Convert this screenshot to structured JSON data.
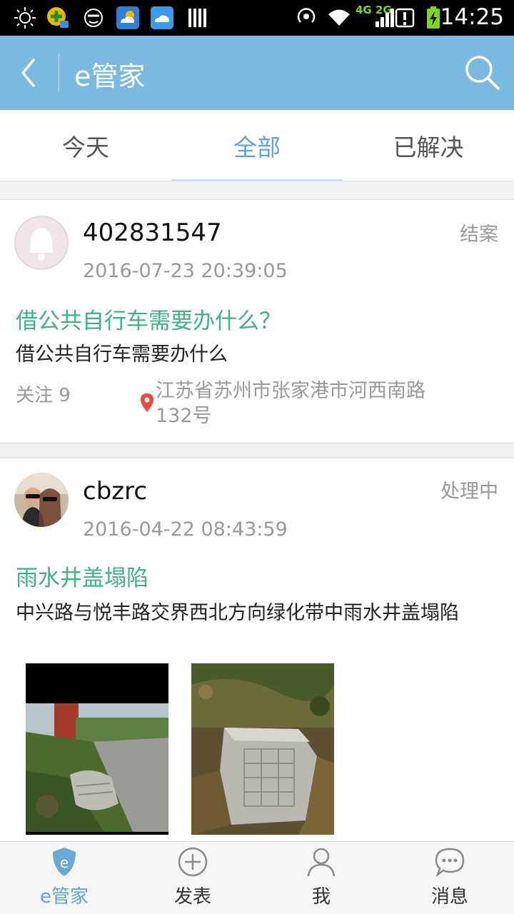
{
  "status_bar": {
    "time": "14:25",
    "network": "4G 2G"
  },
  "header": {
    "title": "e管家"
  },
  "tabs": [
    {
      "label": "今天"
    },
    {
      "label": "全部"
    },
    {
      "label": "已解决"
    }
  ],
  "posts": [
    {
      "username": "402831547",
      "datetime": "2016-07-23 20:39:05",
      "status": "结案",
      "title": "借公共自行车需要办什么？",
      "description": "借公共自行车需要办什么",
      "follow": "关注 9",
      "location": "江苏省苏州市张家港市河西南路132号"
    },
    {
      "username": "cbzrc",
      "datetime": "2016-04-22 08:43:59",
      "status": "处理中",
      "title": "雨水井盖塌陷",
      "description": "中兴路与悦丰路交界西北方向绿化带中雨水井盖塌陷"
    }
  ],
  "bottom_nav": [
    {
      "label": "e管家",
      "icon": "shield-e-icon"
    },
    {
      "label": "发表",
      "icon": "plus-circle-icon"
    },
    {
      "label": "我",
      "icon": "person-icon"
    },
    {
      "label": "消息",
      "icon": "chat-bubble-icon"
    }
  ],
  "colors": {
    "accent": "#7bb9e0",
    "tab_active": "#5ea4d3",
    "title_green": "#3fb27f",
    "muted": "#999999"
  }
}
